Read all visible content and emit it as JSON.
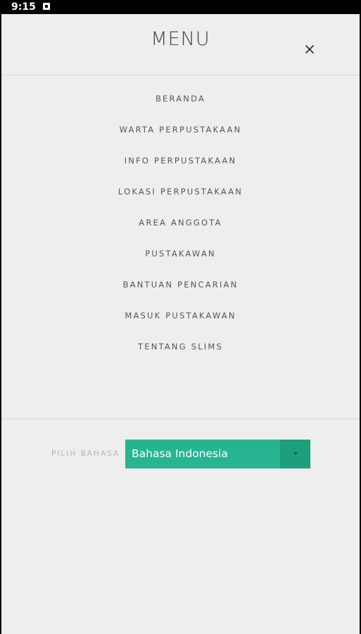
{
  "status_bar": {
    "time": "9:15",
    "notification_icon": "notification-square-icon"
  },
  "header": {
    "title": "MENU",
    "close_icon": "close-icon"
  },
  "nav": {
    "items": [
      {
        "label": "BERANDA"
      },
      {
        "label": "WARTA PERPUSTAKAAN"
      },
      {
        "label": "INFO PERPUSTAKAAN"
      },
      {
        "label": "LOKASI PERPUSTAKAAN"
      },
      {
        "label": "AREA ANGGOTA"
      },
      {
        "label": "PUSTAKAWAN"
      },
      {
        "label": "BANTUAN PENCARIAN"
      },
      {
        "label": "MASUK PUSTAKAWAN"
      },
      {
        "label": "TENTANG SLIMS"
      }
    ]
  },
  "language": {
    "label": "PILIH BAHASA",
    "selected": "Bahasa Indonesia"
  },
  "colors": {
    "background": "#eeeeee",
    "accent": "#26b590",
    "accent_dark": "#1d9e7c",
    "text": "#555555",
    "muted": "#b5b5b5"
  }
}
